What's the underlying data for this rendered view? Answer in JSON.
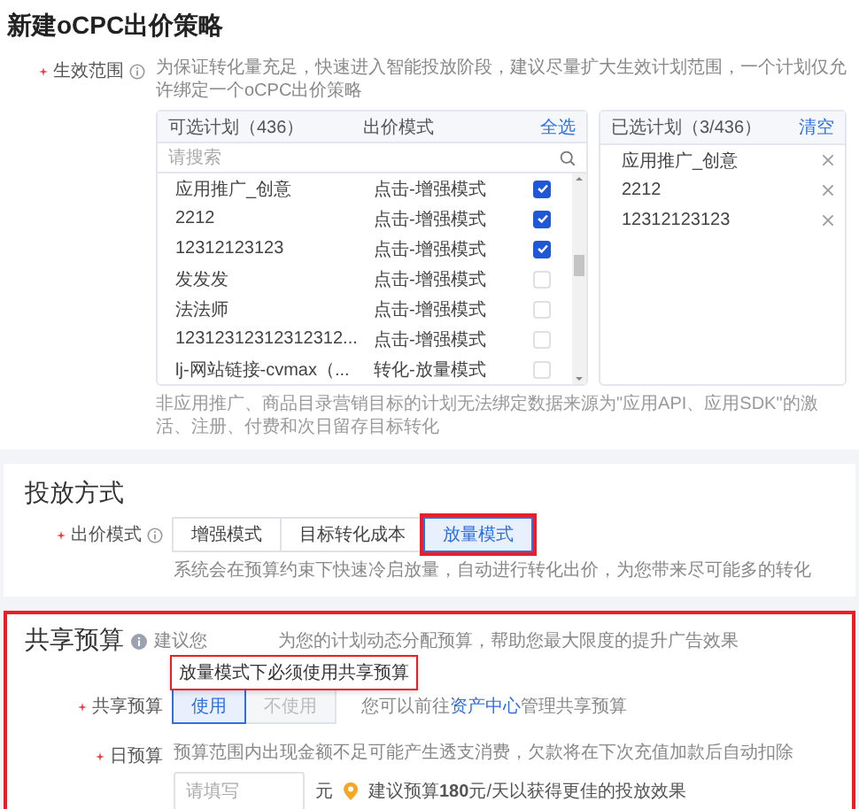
{
  "page_title": "新建oCPC出价策略",
  "scope": {
    "label": "生效范围",
    "required": true,
    "hint": "为保证转化量充足，快速进入智能投放阶段，建议尽量扩大生效计划范围，一个计划仅允许绑定一个oCPC出价策略",
    "available": {
      "title": "可选计划（436）",
      "mode_header": "出价模式",
      "select_all": "全选",
      "search_placeholder": "请搜索",
      "rows": [
        {
          "name": "应用推广_创意",
          "mode": "点击-增强模式",
          "checked": true
        },
        {
          "name": "2212",
          "mode": "点击-增强模式",
          "checked": true
        },
        {
          "name": "12312123123",
          "mode": "点击-增强模式",
          "checked": true
        },
        {
          "name": "发发发",
          "mode": "点击-增强模式",
          "checked": false
        },
        {
          "name": "法法师",
          "mode": "点击-增强模式",
          "checked": false
        },
        {
          "name": "12312312312312312...",
          "mode": "点击-增强模式",
          "checked": false
        },
        {
          "name": "lj-网站链接-cvmax（...",
          "mode": "转化-放量模式",
          "checked": false
        }
      ]
    },
    "selected": {
      "title": "已选计划（3/436）",
      "clear": "清空",
      "items": [
        "应用推广_创意",
        "2212",
        "12312123123"
      ]
    },
    "note": "非应用推广、商品目录营销目标的计划无法绑定数据来源为\"应用API、应用SDK\"的激活、注册、付费和次日留存目标转化"
  },
  "delivery": {
    "title": "投放方式",
    "bid_label": "出价模式",
    "required": true,
    "options": [
      {
        "label": "增强模式",
        "selected": false,
        "highlighted": false
      },
      {
        "label": "目标转化成本",
        "selected": false,
        "highlighted": false
      },
      {
        "label": "放量模式",
        "selected": true,
        "highlighted": true
      }
    ],
    "hint": "系统会在预算约束下快速冷启放量，自动进行转化出价，为您带来尽可能多的转化"
  },
  "shared_budget": {
    "title": "共享预算",
    "highlighted": true,
    "hint_start": "建议您",
    "hint_end": "为您的计划动态分配预算，帮助您最大限度的提升广告效果",
    "tooltip": {
      "text": "放量模式下必须使用共享预算",
      "highlighted": true
    },
    "use_label": "共享预算",
    "use_required": true,
    "use_options": [
      {
        "label": "使用",
        "selected": true,
        "disabled": false
      },
      {
        "label": "不使用",
        "selected": false,
        "disabled": true
      }
    ],
    "manage_before": "您可以前往",
    "manage_link": "资产中心",
    "manage_after": "管理共享预算",
    "daily_label": "日预算",
    "daily_required": true,
    "daily_hint": "预算范围内出现金额不足可能产生透支消费，欠款将在下次充值加款后自动扣除",
    "daily_placeholder": "请填写",
    "unit": "元",
    "suggestion": "建议预算**180**元/天以获得更佳的投放效果"
  }
}
